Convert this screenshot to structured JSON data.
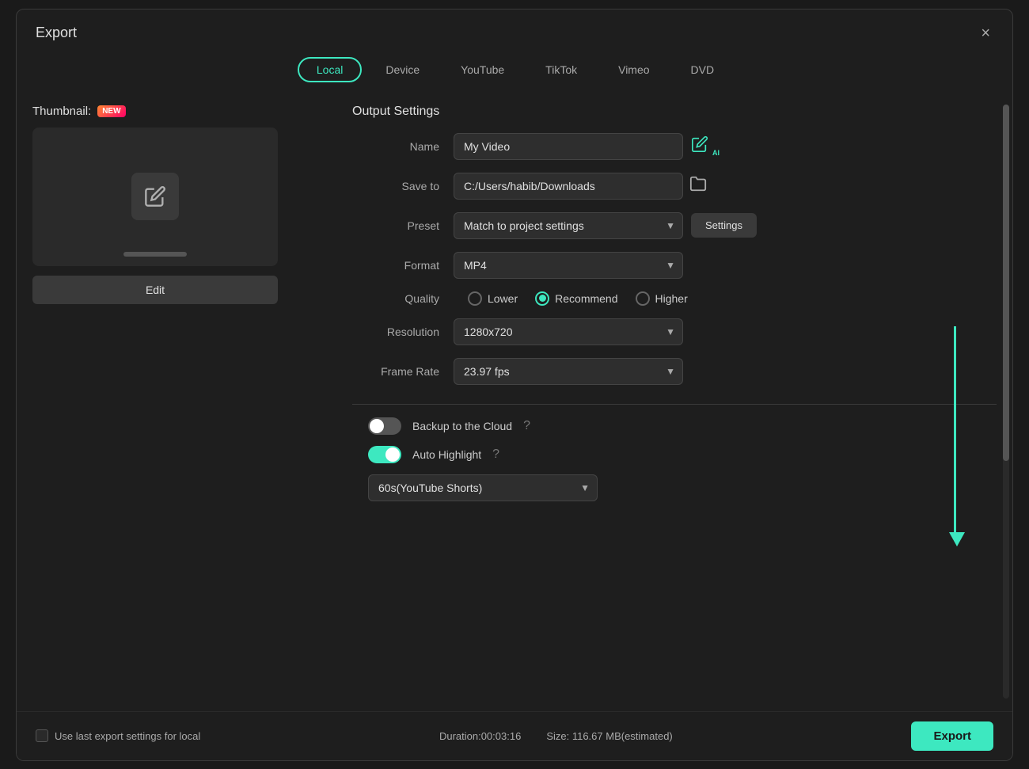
{
  "dialog": {
    "title": "Export",
    "close_label": "×"
  },
  "tabs": [
    {
      "id": "local",
      "label": "Local",
      "active": true
    },
    {
      "id": "device",
      "label": "Device",
      "active": false
    },
    {
      "id": "youtube",
      "label": "YouTube",
      "active": false
    },
    {
      "id": "tiktok",
      "label": "TikTok",
      "active": false
    },
    {
      "id": "vimeo",
      "label": "Vimeo",
      "active": false
    },
    {
      "id": "dvd",
      "label": "DVD",
      "active": false
    }
  ],
  "thumbnail": {
    "label": "Thumbnail:",
    "badge": "NEW",
    "edit_btn": "Edit"
  },
  "output_settings": {
    "title": "Output Settings",
    "name_label": "Name",
    "name_value": "My Video",
    "save_to_label": "Save to",
    "save_to_value": "C:/Users/habib/Downloads",
    "preset_label": "Preset",
    "preset_value": "Match to project settings",
    "settings_btn": "Settings",
    "format_label": "Format",
    "format_value": "MP4",
    "quality_label": "Quality",
    "quality_options": [
      {
        "id": "lower",
        "label": "Lower",
        "checked": false
      },
      {
        "id": "recommend",
        "label": "Recommend",
        "checked": true
      },
      {
        "id": "higher",
        "label": "Higher",
        "checked": false
      }
    ],
    "resolution_label": "Resolution",
    "resolution_value": "1280x720",
    "frame_rate_label": "Frame Rate",
    "frame_rate_value": "23.97 fps",
    "backup_cloud_label": "Backup to the Cloud",
    "backup_cloud_on": false,
    "auto_highlight_label": "Auto Highlight",
    "auto_highlight_on": true,
    "highlight_dropdown": "60s(YouTube Shorts)"
  },
  "bottom_bar": {
    "use_last_label": "Use last export settings for local",
    "duration_label": "Duration:00:03:16",
    "size_label": "Size: 116.67 MB(estimated)",
    "export_btn": "Export"
  }
}
